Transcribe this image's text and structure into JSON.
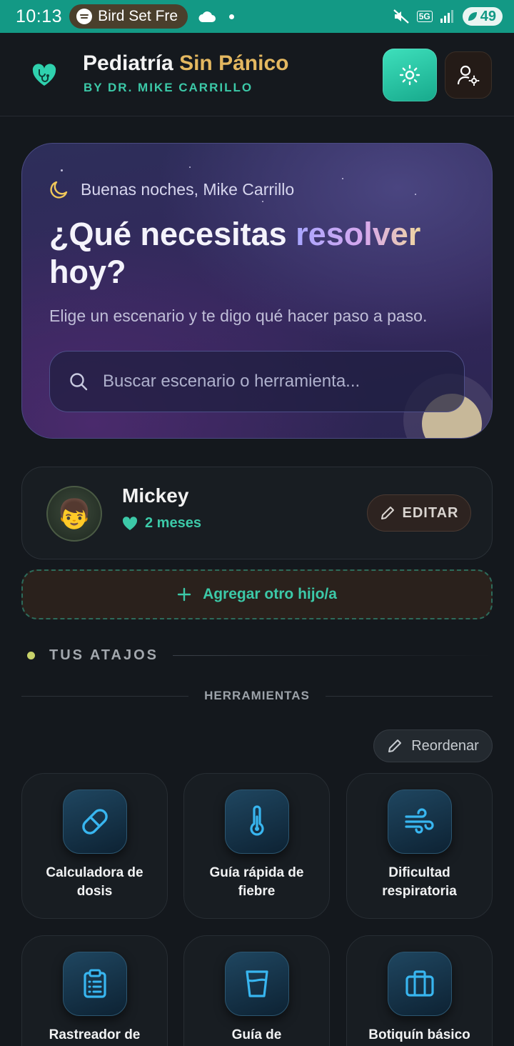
{
  "status_bar": {
    "time": "10:13",
    "media_title": "Bird Set Fre",
    "network": "5G",
    "battery": "49"
  },
  "header": {
    "title_main": "Pediatría",
    "title_accent": "Sin Pánico",
    "subtitle": "BY DR. MIKE CARRILLO",
    "accent_color": "#3cc9a8",
    "title_accent_color": "#e4b860"
  },
  "hero": {
    "greeting": "Buenas noches, Mike Carrillo",
    "title_start": "¿Qué necesitas",
    "title_highlight": "resolver",
    "title_end": "hoy?",
    "subtitle": "Elige un escenario y te digo qué hacer paso a paso.",
    "search_placeholder": "Buscar escenario o herramienta..."
  },
  "child": {
    "name": "Mickey",
    "age": "2 meses",
    "avatar": "👦",
    "edit_label": "EDITAR"
  },
  "add_child_label": "Agregar otro hijo/a",
  "shortcuts": {
    "section_title": "TUS ATAJOS",
    "subsection_title": "HERRAMIENTAS",
    "reorder_label": "Reordenar",
    "tools": [
      {
        "label": "Calculadora de dosis",
        "icon": "pill-icon"
      },
      {
        "label": "Guía rápida de fiebre",
        "icon": "thermometer-icon"
      },
      {
        "label": "Dificultad respiratoria",
        "icon": "wind-icon"
      },
      {
        "label": "Rastreador de",
        "icon": "clipboard-icon"
      },
      {
        "label": "Guía de",
        "icon": "cup-icon"
      },
      {
        "label": "Botiquín básico",
        "icon": "briefcase-icon"
      }
    ]
  }
}
